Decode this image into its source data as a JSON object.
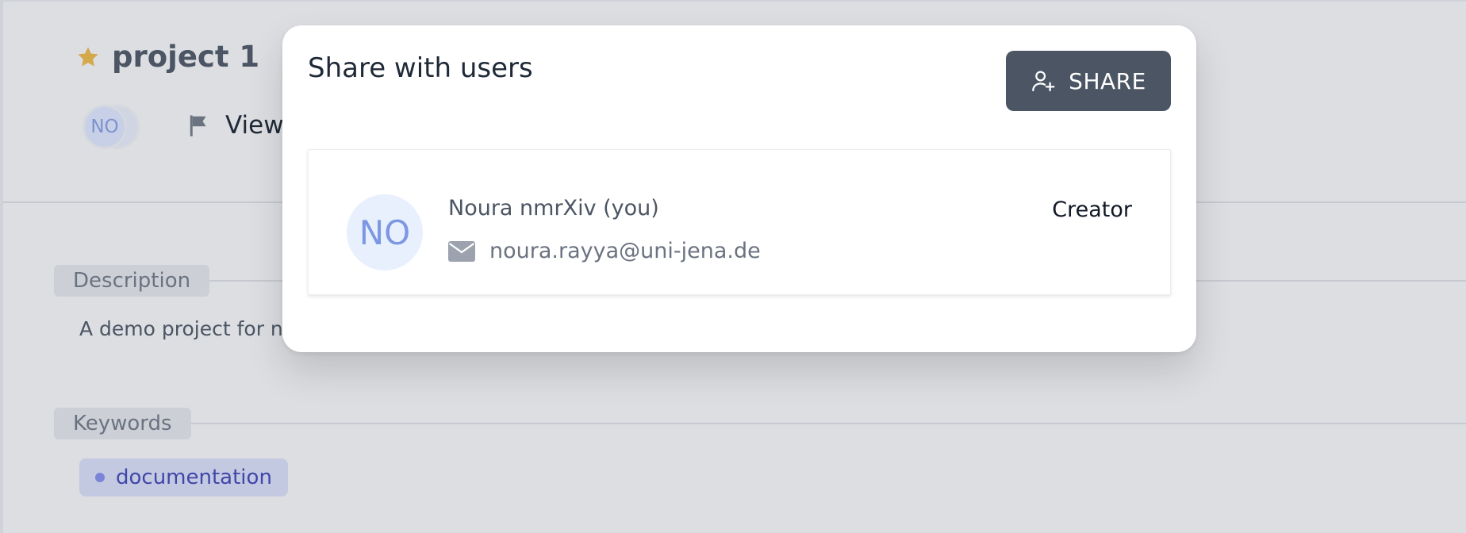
{
  "page": {
    "project_title": "project 1",
    "avatar_initials": "NO",
    "view_label": "View",
    "description_label": "Description",
    "description_text": "A demo project for n",
    "keywords_label": "Keywords",
    "keywords": [
      "documentation"
    ]
  },
  "modal": {
    "title": "Share with users",
    "share_button_label": "SHARE",
    "users": [
      {
        "initials": "NO",
        "name": "Noura nmrXiv (you)",
        "email": "noura.rayya@uni-jena.de",
        "role": "Creator"
      }
    ]
  },
  "colors": {
    "accent_star": "#d4a94c",
    "share_button": "#4b5563",
    "avatar_bg": "#e8f0fd",
    "avatar_text": "#7d97e2",
    "tag_bg": "#c4c9e2",
    "tag_text": "#3f47a8"
  },
  "icons": {
    "star": "star-icon",
    "flag": "flag-icon",
    "add_user": "user-plus-icon",
    "mail": "envelope-icon"
  }
}
